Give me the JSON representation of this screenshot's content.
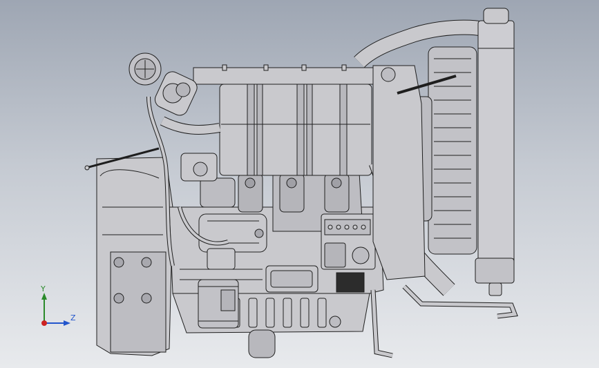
{
  "view": {
    "background_top": "#9ea6b3",
    "background_bottom": "#e8eaed",
    "model_fill": "#c9c9cd",
    "model_stroke": "#1e1e1e",
    "model_shadow": "#a8a8ae"
  },
  "triad": {
    "y_label": "Y",
    "z_label": "Z",
    "y_color": "#2a8a2a",
    "z_color": "#2255cc",
    "x_color": "#cc2222"
  }
}
